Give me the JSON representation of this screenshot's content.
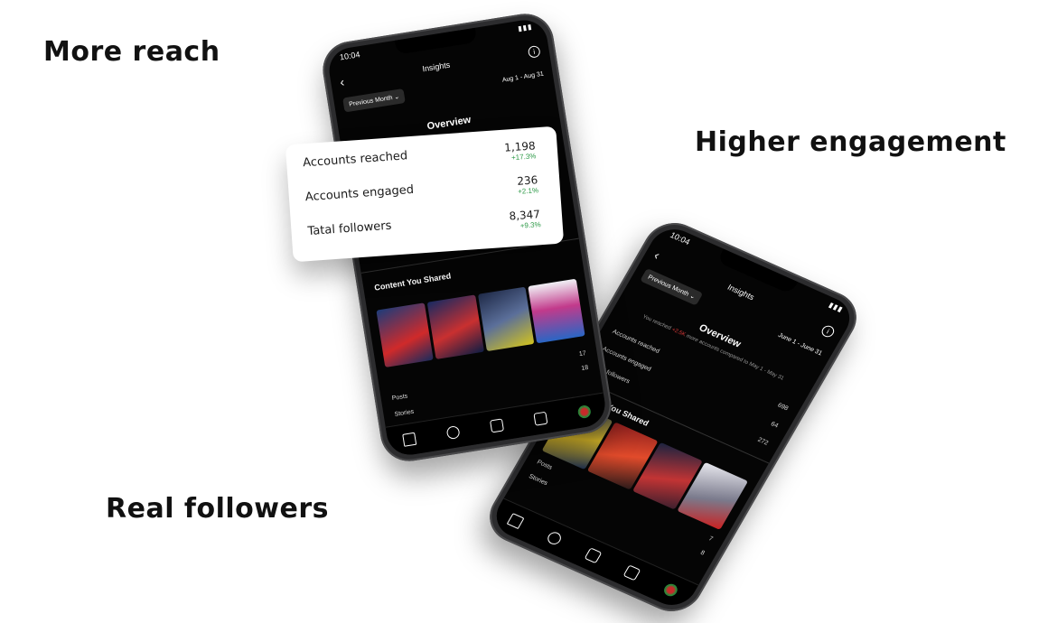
{
  "headlines": {
    "reach": "More reach",
    "engagement": "Higher engagement",
    "followers": "Real followers"
  },
  "phone_front": {
    "time": "10:04",
    "signal": "..ll",
    "title": "Insights",
    "back_icon": "chevron-left-icon",
    "info_icon": "info-icon",
    "filter_label": "Previous Month",
    "date_range": "Aug 1 - Aug 31",
    "overview_title": "Overview",
    "content_title": "Content You Shared",
    "count_top": "17",
    "posts_label": "Posts",
    "posts_count": "18",
    "stories_label": "Stories"
  },
  "stats_card": {
    "rows": [
      {
        "label": "Accounts reached",
        "value": "1,198",
        "delta": "+17.3%"
      },
      {
        "label": "Accounts engaged",
        "value": "236",
        "delta": "+2.1%"
      },
      {
        "label": "Tatal followers",
        "value": "8,347",
        "delta": "+9.3%"
      }
    ]
  },
  "phone_back": {
    "time": "10:04",
    "title": "Insights",
    "filter_label": "Previous Month",
    "date_range": "June 1 - June 31",
    "overview_title": "Overview",
    "reach_text_prefix": "You reached",
    "reach_delta": "+2.5K",
    "reach_text_suffix": "more accounts compared to May 1 - May 31",
    "rows": [
      {
        "label": "Accounts reached",
        "value": "698"
      },
      {
        "label": "Accounts engaged",
        "value": "64"
      },
      {
        "label": "Total followers",
        "value": "272"
      }
    ],
    "content_title": "Content You Shared",
    "posts_label": "Posts",
    "posts_count": "7",
    "stories_label": "Stories",
    "stories_count": "8"
  },
  "icons": [
    "home-icon",
    "search-icon",
    "reels-icon",
    "shop-icon",
    "profile-avatar"
  ]
}
